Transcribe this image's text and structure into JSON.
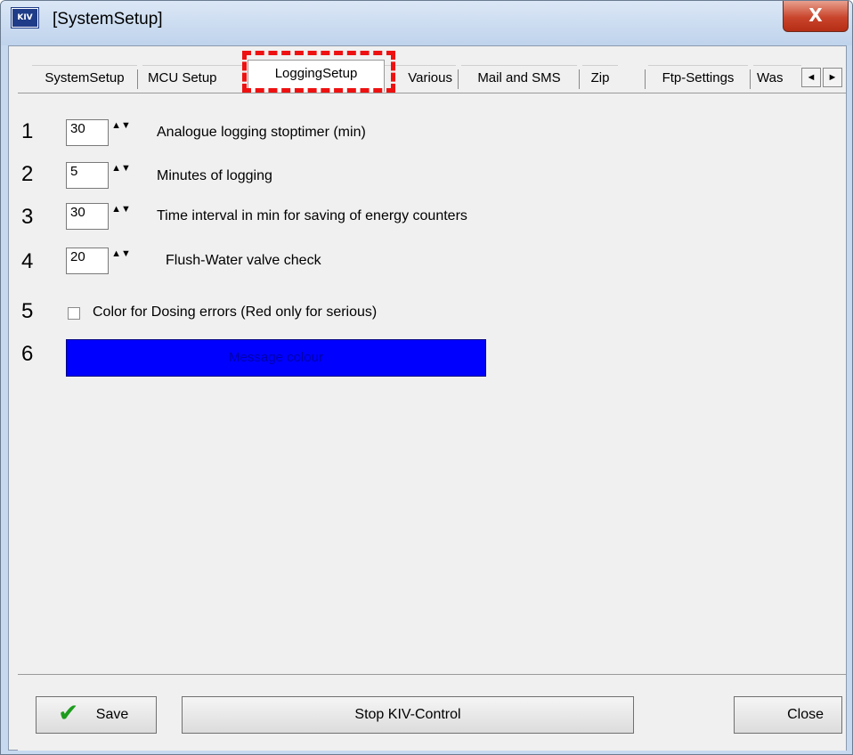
{
  "window": {
    "title": "[SystemSetup]",
    "app_icon_text": "KIV",
    "close_symbol": "X"
  },
  "tabs": [
    {
      "label": "SystemSetup"
    },
    {
      "label": "MCU Setup"
    },
    {
      "label": "LoggingSetup",
      "active": true
    },
    {
      "label": "Various"
    },
    {
      "label": "Mail and SMS"
    },
    {
      "label": "Zip"
    },
    {
      "label": "Ftp-Settings"
    },
    {
      "label": "Was"
    }
  ],
  "tab_scroll": {
    "left_symbol": "◄",
    "right_symbol": "►"
  },
  "rows": [
    {
      "number": "1",
      "value": "30",
      "label": "Analogue logging stoptimer (min)"
    },
    {
      "number": "2",
      "value": "5",
      "label": "Minutes of logging"
    },
    {
      "number": "3",
      "value": "30",
      "label": "Time interval in min for saving of energy counters"
    },
    {
      "number": "4",
      "value": "20",
      "label": "Flush-Water valve check"
    },
    {
      "number": "5",
      "label": "Color for Dosing errors (Red only for serious)",
      "checked": false
    },
    {
      "number": "6",
      "label": "Message colour",
      "color": "#0000ff"
    }
  ],
  "spin_symbol": "▲▼",
  "buttons": {
    "save": "Save",
    "stop": "Stop KIV-Control",
    "close": "Close"
  },
  "icons": {
    "check": "✔"
  },
  "colors": {
    "highlight": "#ee1111",
    "message_colour": "#0000ff"
  }
}
